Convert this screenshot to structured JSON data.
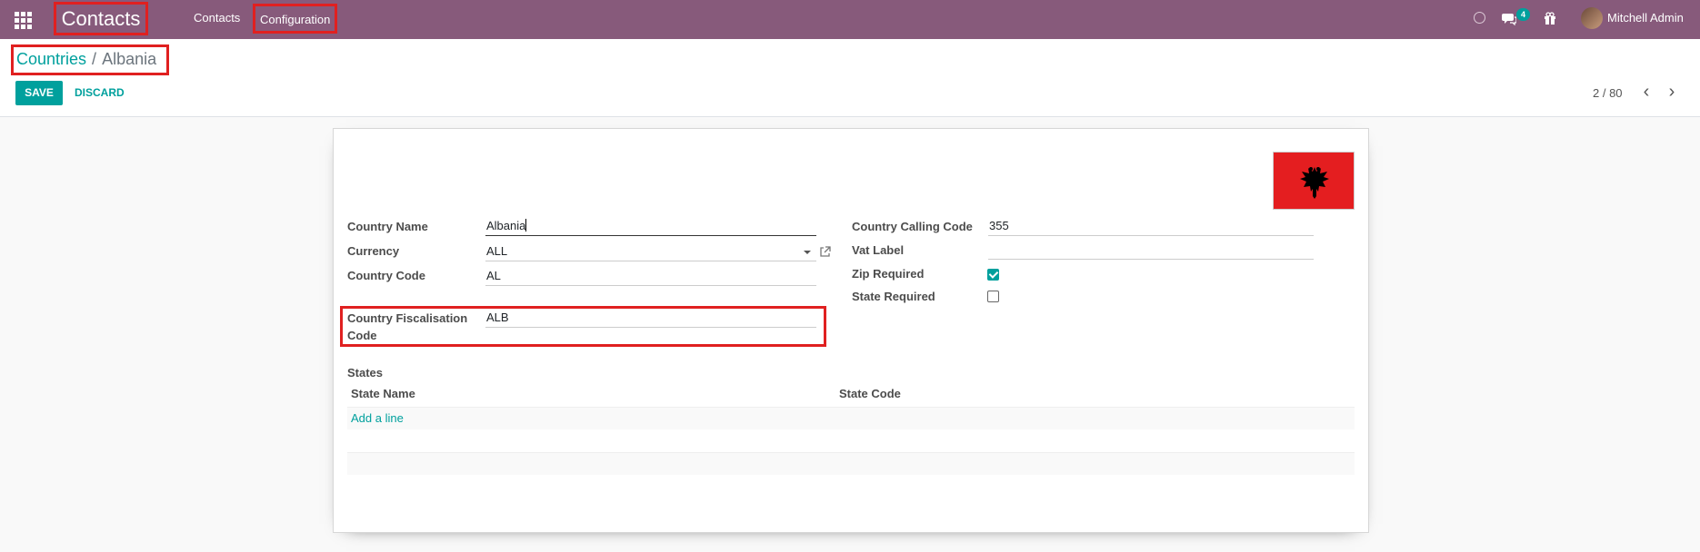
{
  "navbar": {
    "brand": "Contacts",
    "menu": [
      "Contacts",
      "Configuration"
    ],
    "chat_count": "4",
    "user_name": "Mitchell Admin",
    "icons": [
      "apps-grid-icon",
      "clock-icon",
      "chat-icon",
      "gift-icon"
    ]
  },
  "breadcrumb": {
    "parent": "Countries",
    "separator": "/",
    "current": "Albania"
  },
  "actions": {
    "save": "SAVE",
    "discard": "DISCARD"
  },
  "pager": {
    "value": "2 / 80"
  },
  "form": {
    "country_name": {
      "label": "Country Name",
      "value": "Albania"
    },
    "currency": {
      "label": "Currency",
      "value": "ALL"
    },
    "country_code": {
      "label": "Country Code",
      "value": "AL"
    },
    "fiscal_code": {
      "label_line1": "Country Fiscalisation",
      "label_line2": "Code",
      "value": "ALB"
    },
    "calling_code": {
      "label": "Country Calling Code",
      "value": "355"
    },
    "vat_label": {
      "label": "Vat Label",
      "value": ""
    },
    "zip_required": {
      "label": "Zip Required",
      "checked": true
    },
    "state_required": {
      "label": "State Required",
      "checked": false
    }
  },
  "states": {
    "title": "States",
    "columns": [
      "State Name",
      "State Code"
    ],
    "add_line": "Add a line"
  },
  "colors": {
    "navbar": "#875a7b",
    "accent": "#00a09d",
    "highlight": "#e02020",
    "flag_red": "#e41e20"
  }
}
